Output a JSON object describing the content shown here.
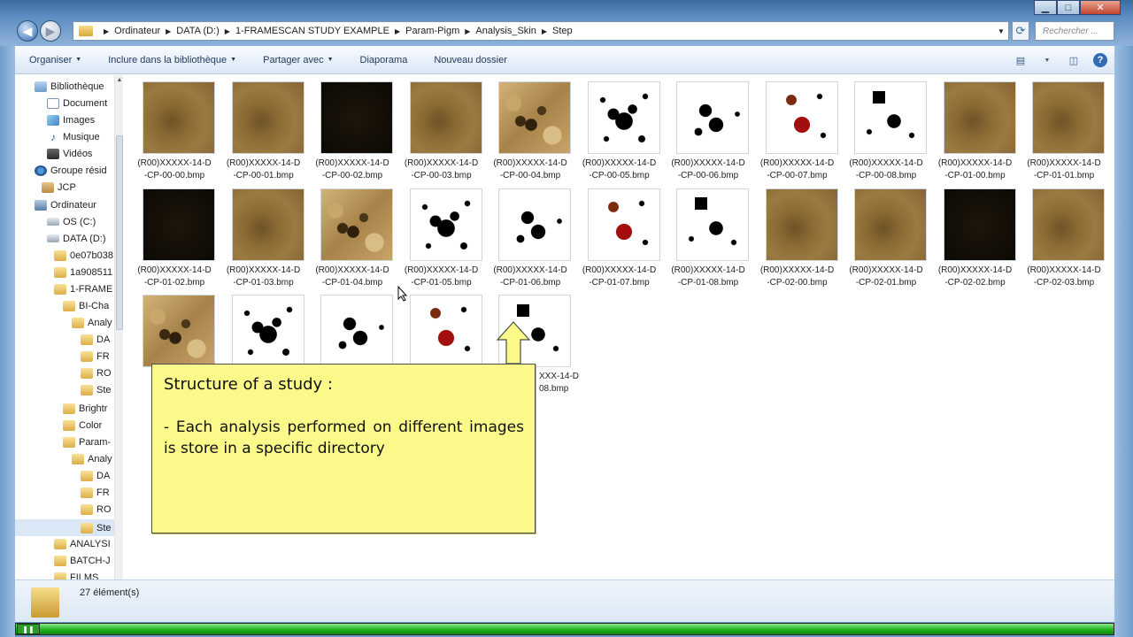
{
  "window": {
    "buttons": {
      "minimize": "▁",
      "maximize": "□",
      "close": "✕"
    }
  },
  "address": {
    "crumbs": [
      "Ordinateur",
      "DATA (D:)",
      "1-FRAMESCAN STUDY EXAMPLE",
      "Param-Pigm",
      "Analysis_Skin",
      "Step"
    ],
    "search_placeholder": "Rechercher ..."
  },
  "toolbar": {
    "organiser": "Organiser",
    "inclure": "Inclure dans la bibliothèque",
    "partager": "Partager avec",
    "diaporama": "Diaporama",
    "nouveau": "Nouveau dossier"
  },
  "nav": {
    "items": [
      {
        "label": "Bibliothèque",
        "icon": "library-icon"
      },
      {
        "label": "Document",
        "icon": "document-icon"
      },
      {
        "label": "Images",
        "icon": "images-icon"
      },
      {
        "label": "Musique",
        "icon": "music-icon"
      },
      {
        "label": "Vidéos",
        "icon": "video-icon"
      },
      {
        "label": "Groupe résid",
        "icon": "homegroup-icon"
      },
      {
        "label": "JCP",
        "icon": "user-icon"
      },
      {
        "label": "Ordinateur",
        "icon": "computer-icon"
      },
      {
        "label": "OS (C:)",
        "icon": "drive-icon"
      },
      {
        "label": "DATA (D:)",
        "icon": "drive-icon"
      },
      {
        "label": "0e07b038",
        "icon": "locked-folder-icon"
      },
      {
        "label": "1a908511",
        "icon": "locked-folder-icon"
      },
      {
        "label": "1-FRAME",
        "icon": "folder-icon"
      },
      {
        "label": "BI-Cha",
        "icon": "folder-icon"
      },
      {
        "label": "Analy",
        "icon": "folder-icon"
      },
      {
        "label": "DA",
        "icon": "folder-icon"
      },
      {
        "label": "FR",
        "icon": "folder-icon"
      },
      {
        "label": "RO",
        "icon": "folder-icon"
      },
      {
        "label": "Ste",
        "icon": "folder-icon"
      },
      {
        "label": "Brightr",
        "icon": "folder-icon"
      },
      {
        "label": "Color",
        "icon": "folder-icon"
      },
      {
        "label": "Param-",
        "icon": "folder-icon"
      },
      {
        "label": "Analy",
        "icon": "folder-icon"
      },
      {
        "label": "DA",
        "icon": "folder-icon"
      },
      {
        "label": "FR",
        "icon": "folder-icon"
      },
      {
        "label": "RO",
        "icon": "folder-icon"
      },
      {
        "label": "Ste",
        "icon": "folder-icon"
      },
      {
        "label": "ANALYSI",
        "icon": "folder-icon"
      },
      {
        "label": "BATCH-J",
        "icon": "folder-icon"
      },
      {
        "label": "FILMS",
        "icon": "folder-icon"
      }
    ]
  },
  "files": [
    {
      "l1": "(R00)XXXXX-14-D",
      "l2": "-CP-00-00.bmp",
      "style": "brown"
    },
    {
      "l1": "(R00)XXXXX-14-D",
      "l2": "-CP-00-01.bmp",
      "style": "brown"
    },
    {
      "l1": "(R00)XXXXX-14-D",
      "l2": "-CP-00-02.bmp",
      "style": "dark"
    },
    {
      "l1": "(R00)XXXXX-14-D",
      "l2": "-CP-00-03.bmp",
      "style": "brown"
    },
    {
      "l1": "(R00)XXXXX-14-D",
      "l2": "-CP-00-04.bmp",
      "style": "tex"
    },
    {
      "l1": "(R00)XXXXX-14-D",
      "l2": "-CP-00-05.bmp",
      "style": "bw"
    },
    {
      "l1": "(R00)XXXXX-14-D",
      "l2": "-CP-00-06.bmp",
      "style": "bw2"
    },
    {
      "l1": "(R00)XXXXX-14-D",
      "l2": "-CP-00-07.bmp",
      "style": "red"
    },
    {
      "l1": "(R00)XXXXX-14-D",
      "l2": "-CP-00-08.bmp",
      "style": "box"
    },
    {
      "l1": "(R00)XXXXX-14-D",
      "l2": "-CP-01-00.bmp",
      "style": "brown"
    },
    {
      "l1": "(R00)XXXXX-14-D",
      "l2": "-CP-01-01.bmp",
      "style": "brown"
    },
    {
      "l1": "(R00)XXXXX-14-D",
      "l2": "-CP-01-02.bmp",
      "style": "dark"
    },
    {
      "l1": "(R00)XXXXX-14-D",
      "l2": "-CP-01-03.bmp",
      "style": "brown"
    },
    {
      "l1": "(R00)XXXXX-14-D",
      "l2": "-CP-01-04.bmp",
      "style": "tex"
    },
    {
      "l1": "(R00)XXXXX-14-D",
      "l2": "-CP-01-05.bmp",
      "style": "bw"
    },
    {
      "l1": "(R00)XXXXX-14-D",
      "l2": "-CP-01-06.bmp",
      "style": "bw2"
    },
    {
      "l1": "(R00)XXXXX-14-D",
      "l2": "-CP-01-07.bmp",
      "style": "red"
    },
    {
      "l1": "(R00)XXXXX-14-D",
      "l2": "-CP-01-08.bmp",
      "style": "box"
    },
    {
      "l1": "(R00)XXXXX-14-D",
      "l2": "-CP-02-00.bmp",
      "style": "brown"
    },
    {
      "l1": "(R00)XXXXX-14-D",
      "l2": "-CP-02-01.bmp",
      "style": "brown"
    },
    {
      "l1": "(R00)XXXXX-14-D",
      "l2": "-CP-02-02.bmp",
      "style": "dark"
    },
    {
      "l1": "(R00)XXXXX-14-D",
      "l2": "-CP-02-03.bmp",
      "style": "brown"
    },
    {
      "l1": "(R",
      "l2": "",
      "style": "tex"
    },
    {
      "l1": "",
      "l2": "",
      "style": "bw"
    },
    {
      "l1": "",
      "l2": "",
      "style": "bw2"
    },
    {
      "l1": "",
      "l2": "",
      "style": "red"
    },
    {
      "l1": "XXX-14-D",
      "l2": "08.bmp",
      "style": "box"
    }
  ],
  "callout": {
    "title": "Structure of a study :",
    "body": "- Each analysis performed on different images is store in a specific directory"
  },
  "status": {
    "count": "27 élément(s)"
  },
  "progress": {
    "fraction": 1.0
  },
  "colors": {
    "callout_bg": "#fbf98a",
    "progress": "#21b41f",
    "accent": "#2f6cb4"
  }
}
